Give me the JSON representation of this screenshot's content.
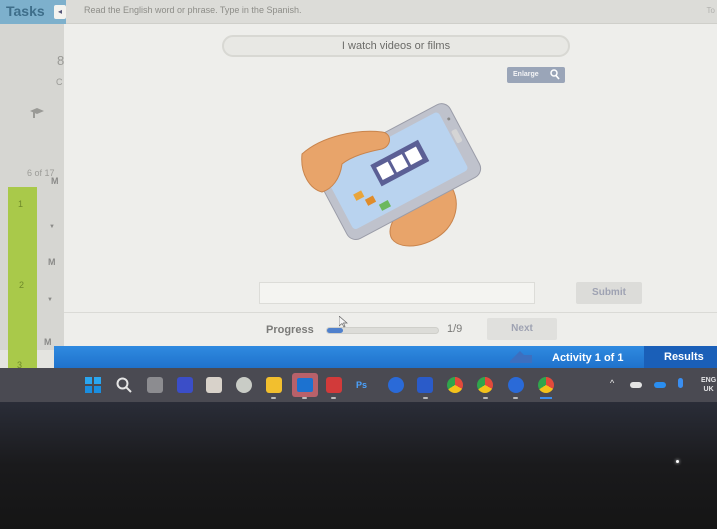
{
  "topbar": {
    "tasks_label": "Tasks",
    "collapse_glyph": "◂",
    "instruction": "Read the English word or phrase. Type in the Spanish.",
    "right_text": "To"
  },
  "task_panel": {
    "partial_number": "8",
    "partial_letter": "C",
    "count_label": "6 of 17",
    "items": [
      {
        "number": "1",
        "label": "M"
      },
      {
        "number": "2",
        "label": "M"
      },
      {
        "number": "3",
        "label": "M"
      }
    ]
  },
  "question": {
    "prompt": "I watch videos or films",
    "enlarge_label": "Enlarge",
    "image_alt": "hand holding smartphone showing film strip"
  },
  "answer": {
    "value": "",
    "placeholder": "",
    "submit_label": "Submit"
  },
  "progress": {
    "label": "Progress",
    "current": 1,
    "total": 9,
    "count_text": "1/9",
    "fraction": 0.111,
    "next_label": "Next"
  },
  "footer": {
    "activity_label": "Activity 1 of 1",
    "results_label": "Results"
  },
  "taskbar": {
    "icons": [
      "windows-start-icon",
      "search-icon",
      "task-view-icon",
      "scanner-app-icon",
      "snipping-tool-icon",
      "clock-app-icon",
      "file-explorer-icon",
      "outlook-icon",
      "acrobat-icon",
      "photoshop-icon",
      "copilot-icon",
      "word-icon",
      "chrome-icon",
      "chrome-profile-icon",
      "copilot-icon-2",
      "chrome-profile-icon-2"
    ],
    "lang_line1": "ENG",
    "lang_line2": "UK"
  },
  "colors": {
    "accent_blue": "#1f72cc",
    "task_green": "#a9c94a",
    "tasks_tab": "#7db0cc"
  }
}
